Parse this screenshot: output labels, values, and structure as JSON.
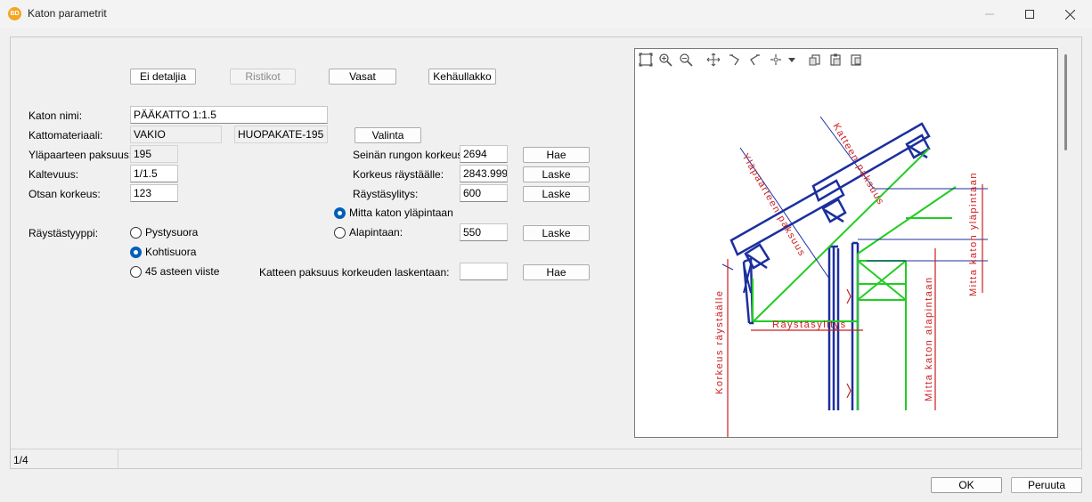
{
  "window": {
    "title": "Katon parametrit",
    "app_icon_text": "BD"
  },
  "tabs": {
    "no_detail": "Ei detaljia",
    "trusses": "Ristikot",
    "rafters": "Vasat",
    "ring_beam": "Kehäullakko"
  },
  "form": {
    "roof_name_label": "Katon nimi:",
    "roof_name_value": "PÄÄKATTO 1:1.5",
    "material_label": "Kattomateriaali:",
    "material_value": "VAKIO",
    "material_type_value": "HUOPAKATE-195",
    "select_button": "Valinta",
    "top_chord_label": "Yläpaarteen paksuus:",
    "top_chord_value": "195",
    "slope_label": "Kaltevuus:",
    "slope_value": "1/1.5",
    "fascia_label": "Otsan korkeus:",
    "fascia_value": "123",
    "eave_type_label": "Räystästyyppi:",
    "eave_types": [
      "Pystysuora",
      "Kohtisuora",
      "45 asteen viiste"
    ],
    "eave_type_selected": "Kohtisuora",
    "wall_height_label": "Seinän rungon korkeus:",
    "wall_height_value": "2694",
    "eave_height_label": "Korkeus räystäälle:",
    "eave_height_value": "2843.999",
    "overhang_label": "Räystäsylitys:",
    "overhang_value": "600",
    "measure_options": [
      "Mitta katon yläpintaan",
      "Alapintaan:"
    ],
    "measure_selected": "Mitta katon yläpintaan",
    "lower_surface_value": "550",
    "cover_thickness_label": "Katteen paksuus korkeuden laskentaan:",
    "cover_thickness_value": "",
    "fetch_button": "Hae",
    "calc_button": "Laske"
  },
  "drawing": {
    "labels": {
      "cover_thickness": "Katteen paksuus",
      "top_chord_thickness": "Yläpaarteen paksuus",
      "measure_to_top": "Mitta katon yläpintaan",
      "measure_to_bottom": "Mitta katon alapintaan",
      "height_to_eave": "Korkeus räystäälle",
      "overhang": "Räystäsylitys"
    },
    "toolbar_icons": [
      "zoom-extents-icon",
      "zoom-in-icon",
      "zoom-out-icon",
      "pan-icon",
      "rotate-left-icon",
      "rotate-right-icon",
      "move-icon",
      "dropdown-icon",
      "copy-icon",
      "paste-icon",
      "export-icon"
    ],
    "colors": {
      "structure": "#1c2f9e",
      "insulation": "#22cc22",
      "dimension": "#cc1f1f",
      "guide": "#1c2f9e"
    }
  },
  "status": {
    "page": "1/4"
  },
  "footer": {
    "ok": "OK",
    "cancel": "Peruuta"
  }
}
